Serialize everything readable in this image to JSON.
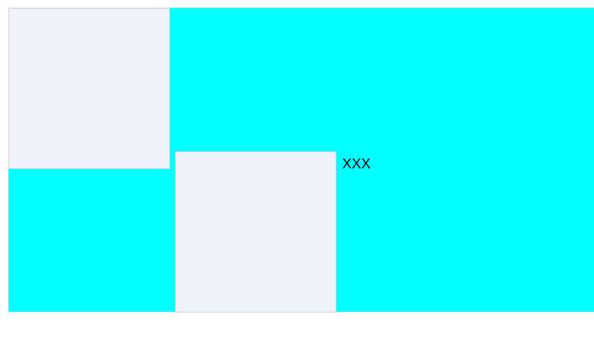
{
  "canvas": {
    "background_color": "#00ffff",
    "box_color": "#eef2fb",
    "box_border_color": "#c8cdd6"
  },
  "inline_text": "XXX"
}
